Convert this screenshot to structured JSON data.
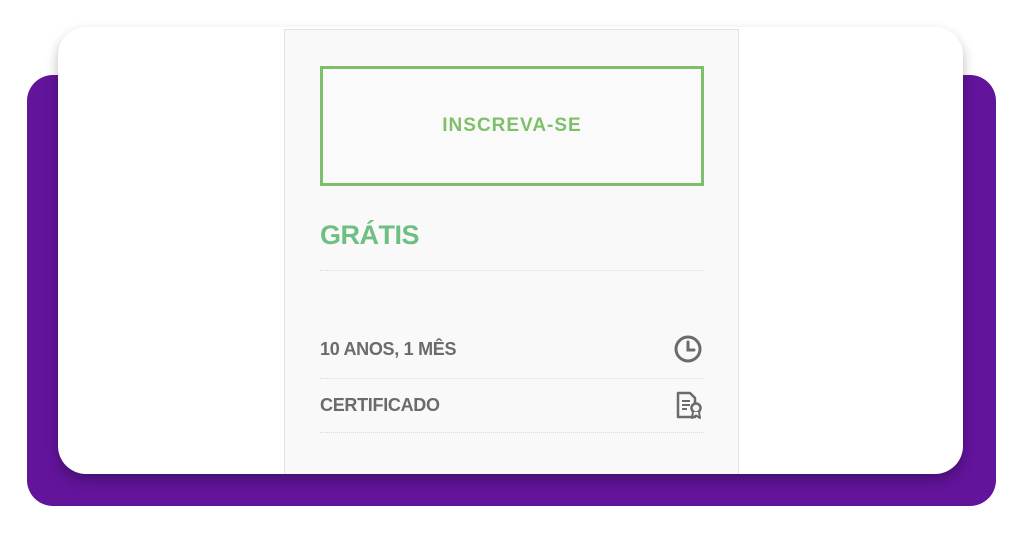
{
  "course": {
    "enroll_label": "INSCREVA-SE",
    "price_label": "GRÁTIS",
    "details": [
      {
        "label": "10 ANOS, 1 MÊS",
        "icon": "clock-icon"
      },
      {
        "label": "CERTIFICADO",
        "icon": "certificate-icon"
      }
    ]
  },
  "colors": {
    "backdrop": "#62149b",
    "accent_green": "#7fbf69",
    "price_green": "#6fbf82",
    "text_gray": "#6b6b6b"
  }
}
